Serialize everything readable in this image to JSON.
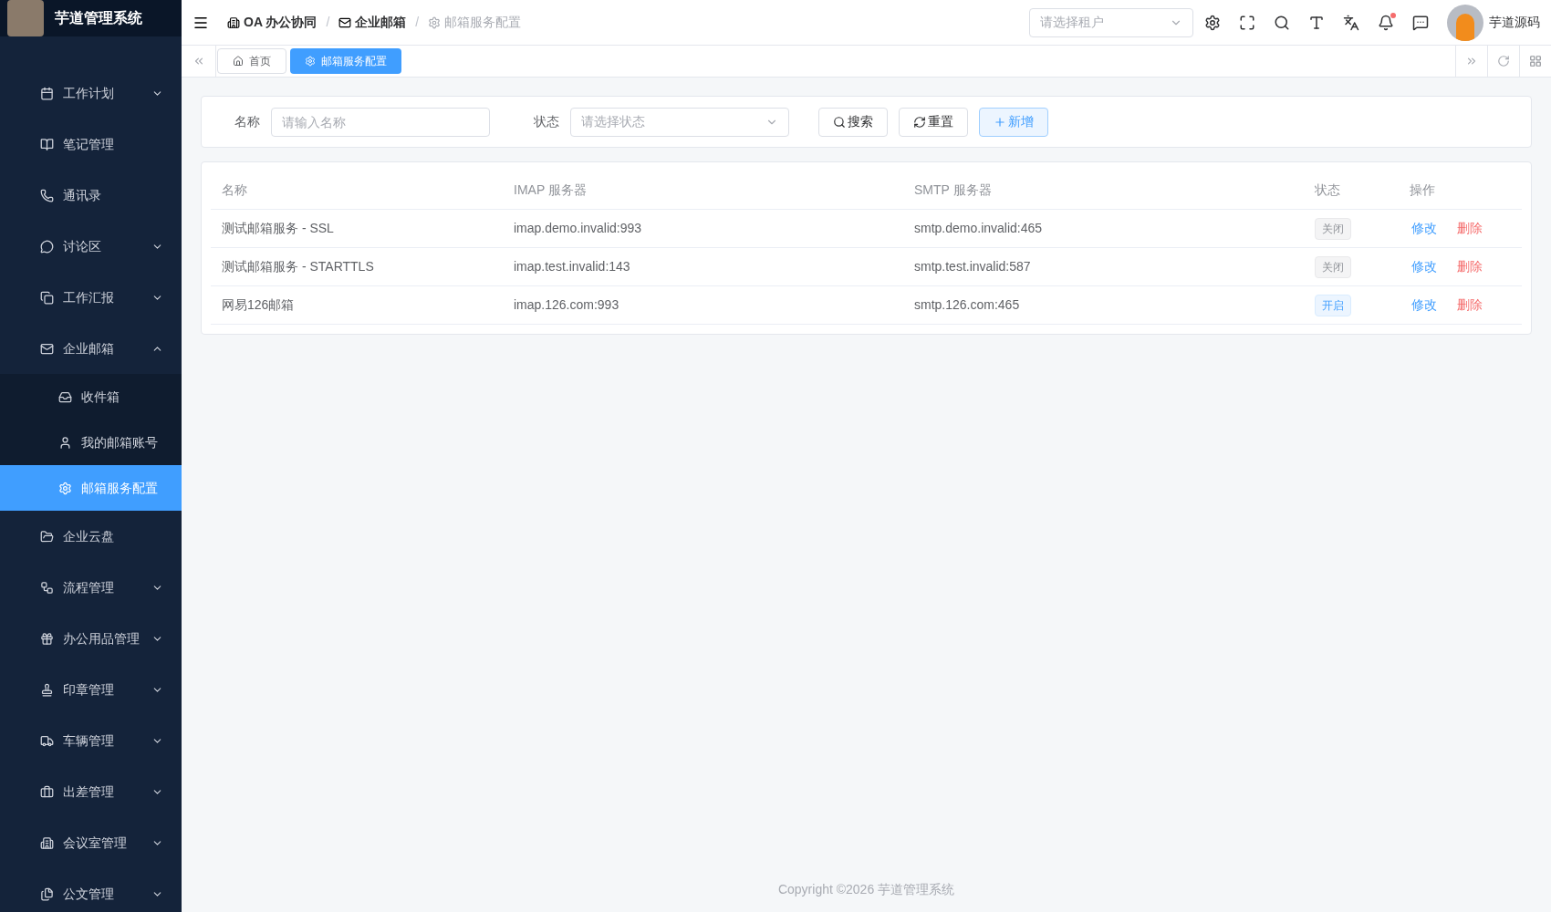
{
  "app_title": "芋道管理系统",
  "sidebar": {
    "items": [
      {
        "label": "工作计划",
        "expanded": false,
        "selected": false
      },
      {
        "label": "笔记管理",
        "selected": false
      },
      {
        "label": "通讯录",
        "selected": false
      },
      {
        "label": "讨论区",
        "expanded": false,
        "selected": false
      },
      {
        "label": "工作汇报",
        "expanded": false,
        "selected": false
      },
      {
        "label": "企业邮箱",
        "expanded": true,
        "selected": false,
        "children": [
          {
            "label": "收件箱",
            "selected": false
          },
          {
            "label": "我的邮箱账号",
            "selected": false
          },
          {
            "label": "邮箱服务配置",
            "selected": true
          }
        ]
      },
      {
        "label": "企业云盘",
        "selected": false
      },
      {
        "label": "流程管理",
        "expanded": false,
        "selected": false
      },
      {
        "label": "办公用品管理",
        "expanded": false,
        "selected": false
      },
      {
        "label": "印章管理",
        "expanded": false,
        "selected": false
      },
      {
        "label": "车辆管理",
        "expanded": false,
        "selected": false
      },
      {
        "label": "出差管理",
        "expanded": false,
        "selected": false
      },
      {
        "label": "会议室管理",
        "expanded": false,
        "selected": false
      },
      {
        "label": "公文管理",
        "expanded": false,
        "selected": false
      }
    ]
  },
  "breadcrumb": {
    "separator": "/",
    "items": [
      {
        "label": "OA 办公协同",
        "current": false
      },
      {
        "label": "企业邮箱",
        "current": false
      },
      {
        "label": "邮箱服务配置",
        "current": true
      }
    ]
  },
  "header": {
    "tenant_select": {
      "placeholder": "请选择租户"
    },
    "has_unread_notifications": true,
    "user_name": "芋道源码"
  },
  "tabs": [
    {
      "label": "首页",
      "selected": false
    },
    {
      "label": "邮箱服务配置",
      "selected": true
    }
  ],
  "search_form": {
    "fields": [
      {
        "label": "名称",
        "placeholder": "请输入名称",
        "kind": "input"
      },
      {
        "label": "状态",
        "placeholder": "请选择状态",
        "kind": "select"
      }
    ],
    "buttons": [
      {
        "label": "搜索",
        "kind": "search"
      },
      {
        "label": "重置",
        "kind": "reset"
      },
      {
        "label": "新增",
        "kind": "add"
      }
    ]
  },
  "table": {
    "columns": [
      "名称",
      "IMAP 服务器",
      "SMTP 服务器",
      "状态",
      "操作"
    ],
    "rows": [
      {
        "name": "测试邮箱服务 - SSL",
        "imap": "imap.demo.invalid:993",
        "smtp": "smtp.demo.invalid:465",
        "status": "关闭",
        "enabled": false,
        "actions": [
          {
            "label": "修改",
            "kind": "edit"
          },
          {
            "label": "删除",
            "kind": "delete"
          }
        ]
      },
      {
        "name": "测试邮箱服务 - STARTTLS",
        "imap": "imap.test.invalid:143",
        "smtp": "smtp.test.invalid:587",
        "status": "关闭",
        "enabled": false,
        "actions": [
          {
            "label": "修改",
            "kind": "edit"
          },
          {
            "label": "删除",
            "kind": "delete"
          }
        ]
      },
      {
        "name": "网易126邮箱",
        "imap": "imap.126.com:993",
        "smtp": "smtp.126.com:465",
        "status": "开启",
        "enabled": true,
        "actions": [
          {
            "label": "修改",
            "kind": "edit"
          },
          {
            "label": "删除",
            "kind": "delete"
          }
        ]
      }
    ]
  },
  "footer": "Copyright ©2026 芋道管理系统"
}
